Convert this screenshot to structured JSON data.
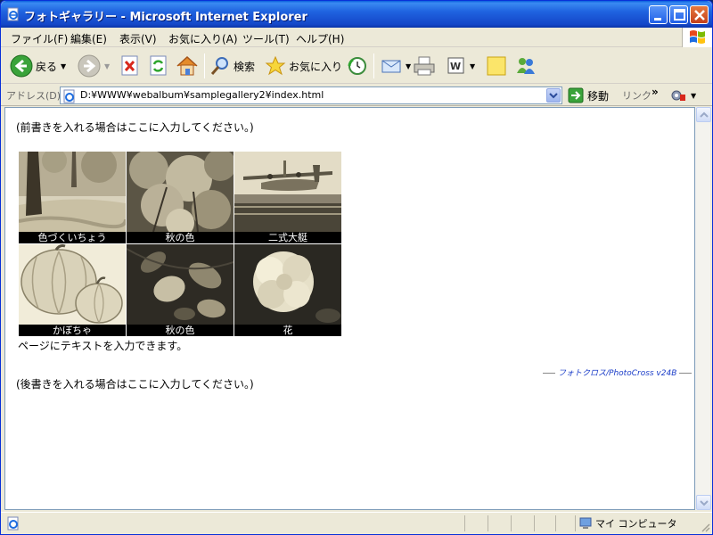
{
  "window": {
    "title": "フォトギャラリー - Microsoft Internet Explorer"
  },
  "menu": {
    "items": [
      {
        "label": "ファイル(F)"
      },
      {
        "label": "編集(E)"
      },
      {
        "label": "表示(V)"
      },
      {
        "label": "お気に入り(A)"
      },
      {
        "label": "ツール(T)"
      },
      {
        "label": "ヘルプ(H)"
      }
    ]
  },
  "toolbar": {
    "back_label": "戻る",
    "search_label": "検索",
    "favorites_label": "お気に入り"
  },
  "address": {
    "label": "アドレス(D)",
    "url": "D:¥WWW¥webalbum¥samplegallery2¥index.html",
    "go_label": "移動",
    "links_label": "リンク"
  },
  "page": {
    "pre_text": "(前書きを入れる場合はここに入力してください。)",
    "gallery": [
      {
        "caption": "色づくいちょう",
        "icon": "ginkgo-tree-photo"
      },
      {
        "caption": "秋の色",
        "icon": "autumn-foliage-photo"
      },
      {
        "caption": "二式大艇",
        "icon": "flying-boat-photo"
      },
      {
        "caption": "かぼちゃ",
        "icon": "pumpkin-photo"
      },
      {
        "caption": "秋の色",
        "icon": "autumn-leaves-photo"
      },
      {
        "caption": "花",
        "icon": "flower-photo"
      }
    ],
    "body_text": "ページにテキストを入力できます。",
    "credit": "フォトクロス/PhotoCross v24B",
    "post_text": "(後書きを入れる場合はここに入力してください。)"
  },
  "status": {
    "zone_label": "マイ コンピュータ"
  },
  "colors": {
    "titlebar": "#1f63e0",
    "window_bg": "#ece9d8",
    "credit_link": "#1a3cc8",
    "caption_bg": "#000000"
  }
}
